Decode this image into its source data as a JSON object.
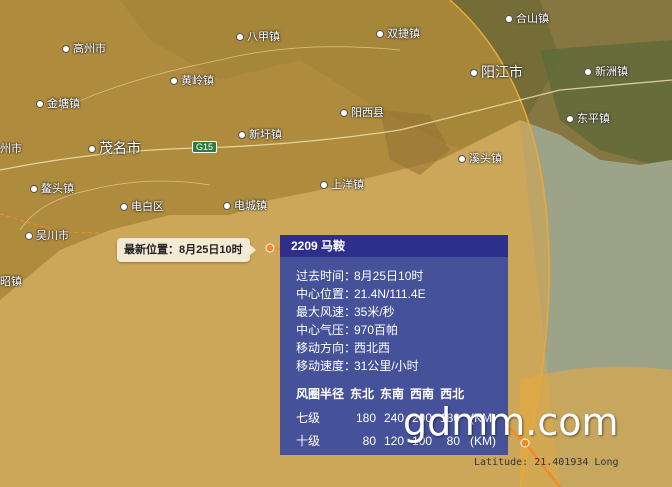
{
  "places": [
    {
      "name": "高州市",
      "big": false
    },
    {
      "name": "八甲镇",
      "big": false
    },
    {
      "name": "黄岭镇",
      "big": false
    },
    {
      "name": "金塘镇",
      "big": false
    },
    {
      "name": "双捷镇",
      "big": false
    },
    {
      "name": "阳江市",
      "big": true
    },
    {
      "name": "合山镇",
      "big": false
    },
    {
      "name": "新洲镇",
      "big": false
    },
    {
      "name": "阳西县",
      "big": false
    },
    {
      "name": "新圩镇",
      "big": false
    },
    {
      "name": "茂名市",
      "big": true
    },
    {
      "name": "州市",
      "big": false
    },
    {
      "name": "鳌头镇",
      "big": false
    },
    {
      "name": "东平镇",
      "big": false
    },
    {
      "name": "溪头镇",
      "big": false
    },
    {
      "name": "上洋镇",
      "big": false
    },
    {
      "name": "电白区",
      "big": false
    },
    {
      "name": "电城镇",
      "big": false
    },
    {
      "name": "吴川市",
      "big": false
    },
    {
      "name": "昭镇",
      "big": false
    }
  ],
  "road_shield": "G15",
  "latest_position": "最新位置：8月25日10时",
  "popup": {
    "title": "2209 马鞍",
    "rows": [
      {
        "key": "过去时间：",
        "value": "8月25日10时"
      },
      {
        "key": "中心位置：",
        "value": "21.4N/111.4E"
      },
      {
        "key": "最大风速：",
        "value": "35米/秒"
      },
      {
        "key": "中心气压：",
        "value": "970百帕"
      },
      {
        "key": "移动方向：",
        "value": "西北西"
      },
      {
        "key": "移动速度：",
        "value": "31公里/小时"
      }
    ],
    "wind_header": [
      "风圈半径",
      "东北",
      "东南",
      "西南",
      "西北"
    ],
    "wind_rows": [
      {
        "level": "七级",
        "values": [
          "180",
          "240",
          "200",
          "180"
        ],
        "unit": "(KM)"
      },
      {
        "level": "十级",
        "values": [
          "80",
          "120",
          "100",
          "80"
        ],
        "unit": "(KM)"
      }
    ]
  },
  "coordinate_readout": "Latitude: 21.401934 Long",
  "watermark": "gdmm.com",
  "colors": {
    "wind_circle": "#e9a93a",
    "track": "#f08a2a",
    "popup_bg": "#3a4b9e",
    "popup_header": "#2e2f8c"
  }
}
